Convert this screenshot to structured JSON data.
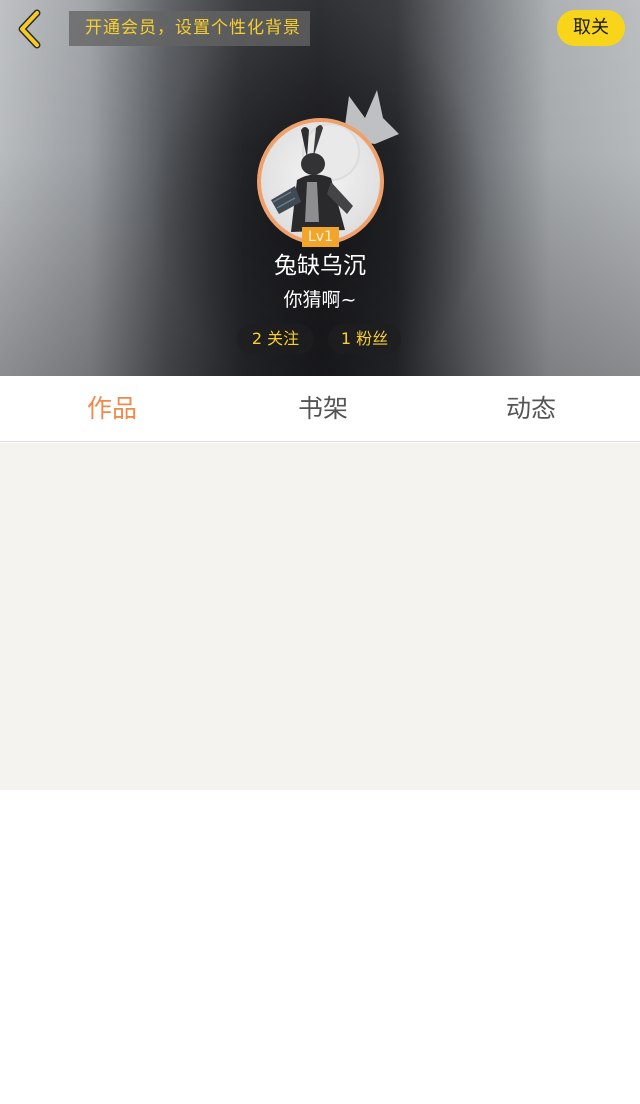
{
  "header": {
    "vip_banner": "开通会员，设置个性化背景",
    "unfollow_label": "取关"
  },
  "profile": {
    "level": "Lv1",
    "nickname": "兔缺乌沉",
    "signature": "你猜啊~",
    "following_label": "2 关注",
    "fans_label": "1 粉丝"
  },
  "tabs": [
    {
      "label": "作品",
      "active": true
    },
    {
      "label": "书架",
      "active": false
    },
    {
      "label": "动态",
      "active": false
    }
  ],
  "colors": {
    "accent": "#f08a4b",
    "vip_yellow": "#f8d51b",
    "level_badge": "#f3a52b"
  },
  "icons": {
    "back": "chevron-left-icon",
    "crown": "crown-icon"
  }
}
